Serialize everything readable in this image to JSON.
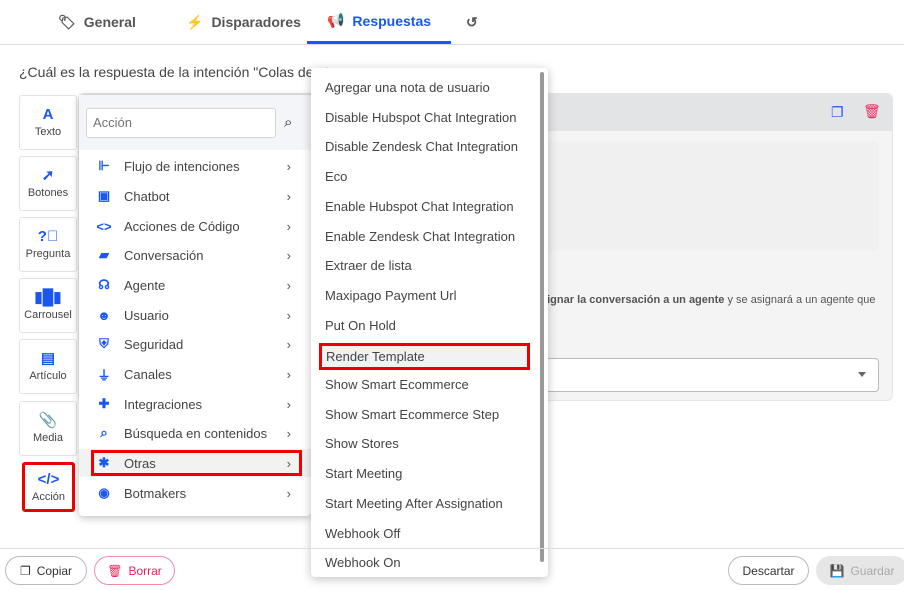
{
  "tabs": [
    {
      "label": "General",
      "icon": "tag-icon"
    },
    {
      "label": "Disparadores",
      "icon": "bolt-icon"
    },
    {
      "label": "Respuestas",
      "icon": "megaphone-icon",
      "active": true
    },
    {
      "label": "",
      "icon": "history-icon"
    }
  ],
  "question": "¿Cuál es la respuesta de la intención \"Colas de at",
  "toolbar": [
    {
      "label": "Texto"
    },
    {
      "label": "Botones"
    },
    {
      "label": "Pregunta"
    },
    {
      "label": "Carrousel"
    },
    {
      "label": "Artículo"
    },
    {
      "label": "Media"
    },
    {
      "label": "Acción",
      "selected": true
    }
  ],
  "card": {
    "desc_bold": "signar la conversación a un agente",
    "desc_rest": " y se asignará a un agente que"
  },
  "menu": {
    "search_placeholder": "Acción",
    "items": [
      {
        "label": "Flujo de intenciones"
      },
      {
        "label": "Chatbot"
      },
      {
        "label": "Acciones de Código"
      },
      {
        "label": "Conversación"
      },
      {
        "label": "Agente"
      },
      {
        "label": "Usuario"
      },
      {
        "label": "Seguridad"
      },
      {
        "label": "Canales"
      },
      {
        "label": "Integraciones"
      },
      {
        "label": "Búsqueda en contenidos"
      },
      {
        "label": "Otras",
        "selected": true
      },
      {
        "label": "Botmakers"
      }
    ]
  },
  "submenu": [
    "Agregar una nota de usuario",
    "Disable Hubspot Chat Integration",
    "Disable Zendesk Chat Integration",
    "Eco",
    "Enable Hubspot Chat Integration",
    "Enable Zendesk Chat Integration",
    "Extraer de lista",
    "Maxipago Payment Url",
    "Put On Hold",
    "Render Template",
    "Show Smart Ecommerce",
    "Show Smart Ecommerce Step",
    "Show Stores",
    "Start Meeting",
    "Start Meeting After Assignation",
    "Webhook Off",
    "Webhook On"
  ],
  "submenu_selected": "Render Template",
  "footer": {
    "copy": "Copiar",
    "delete": "Borrar",
    "discard": "Descartar",
    "save": "Guardar"
  },
  "colors": {
    "accent": "#1a56f0",
    "danger": "#f0235a",
    "highlight": "#e00000"
  }
}
